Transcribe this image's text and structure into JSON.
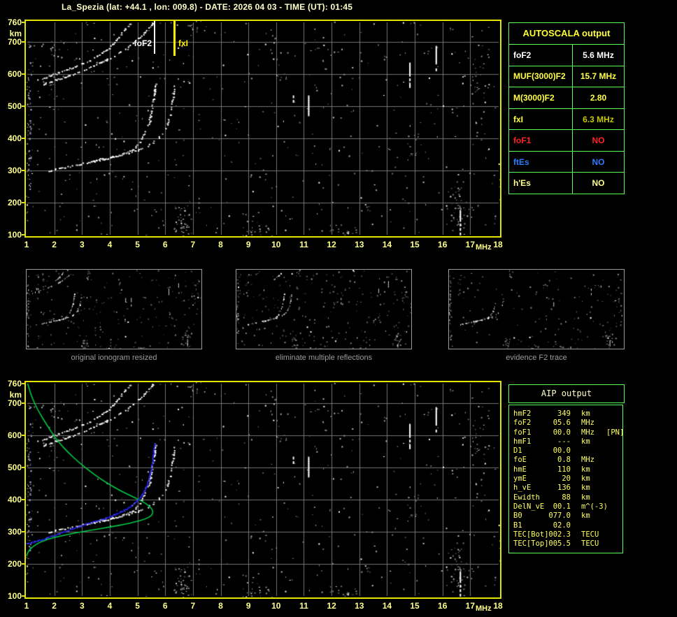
{
  "title": "La_Spezia (lat: +44.1 , lon: 009.8) - DATE: 2026 04 03 - TIME (UT): 01:45",
  "colors": {
    "background": "#000000",
    "plot_border": "#e4e400",
    "grid": "#757575",
    "axis_text": "#ffff8c",
    "table_border": "#55ff55",
    "title_text": "#ffffc8",
    "trace_white": "#ffffff",
    "profile_green": "#00cc44",
    "fitted_blue": "#2020ee"
  },
  "autoscala": {
    "header": "AUTOSCALA output",
    "rows": [
      {
        "key": "foF2",
        "label": "foF2",
        "value": "5.6 MHz",
        "label_color": "#ffffff",
        "value_color": "#ffffff"
      },
      {
        "key": "MUF3000F2",
        "label": "MUF(3000)F2",
        "value": "15.7 MHz",
        "label_color": "#ffff44",
        "value_color": "#ffff44"
      },
      {
        "key": "M3000F2",
        "label": "M(3000)F2",
        "value": "2.80",
        "label_color": "#ffff44",
        "value_color": "#ffff44"
      },
      {
        "key": "fxI",
        "label": "fxI",
        "value": "6.3 MHz",
        "label_color": "#ffff33",
        "value_color": "#c6c600"
      },
      {
        "key": "foF1",
        "label": "foF1",
        "value": "NO",
        "label_color": "#ff2222",
        "value_color": "#ff2222"
      },
      {
        "key": "ftEs",
        "label": "ftEs",
        "value": "NO",
        "label_color": "#2e7bff",
        "value_color": "#2e7bff"
      },
      {
        "key": "hpEs",
        "label": "h'Es",
        "value": "NO",
        "label_color": "#ffff8c",
        "value_color": "#ffff8c"
      }
    ]
  },
  "aip": {
    "header": "AIP output",
    "rows": [
      {
        "name": "hmF2",
        "value": "349",
        "unit": "km",
        "note": ""
      },
      {
        "name": "foF2",
        "value": "05.6",
        "unit": "MHz",
        "note": ""
      },
      {
        "name": "foF1",
        "value": "00.0",
        "unit": "MHz",
        "note": "[PN]"
      },
      {
        "name": "hmF1",
        "value": "---",
        "unit": "km",
        "note": ""
      },
      {
        "name": "D1",
        "value": "00.0",
        "unit": "",
        "note": ""
      },
      {
        "name": "foE",
        "value": "0.8",
        "unit": "MHz",
        "note": ""
      },
      {
        "name": "hmE",
        "value": "110",
        "unit": "km",
        "note": ""
      },
      {
        "name": "ymE",
        "value": "20",
        "unit": "km",
        "note": ""
      },
      {
        "name": "h_vE",
        "value": "136",
        "unit": "km",
        "note": ""
      },
      {
        "name": "Ewidth",
        "value": "88",
        "unit": "km",
        "note": ""
      },
      {
        "name": "DelN_vE",
        "value": "00.1",
        "unit": "m^(-3)",
        "note": ""
      },
      {
        "name": "B0",
        "value": "077.0",
        "unit": "km",
        "note": ""
      },
      {
        "name": "B1",
        "value": "02.0",
        "unit": "",
        "note": ""
      },
      {
        "name": "TEC[Bot]",
        "value": "002.3",
        "unit": "TECU",
        "note": ""
      },
      {
        "name": "TEC[Top]",
        "value": "005.5",
        "unit": "TECU",
        "note": ""
      }
    ]
  },
  "thumbnails": [
    {
      "caption": "original ionogram resized"
    },
    {
      "caption": "eliminate multiple reflections"
    },
    {
      "caption": "evidence F2 trace"
    }
  ],
  "chart_data": [
    {
      "id": "autoscala_ionogram",
      "type": "scatter",
      "xlabel": "MHz",
      "ylabel": "km",
      "xlim": [
        1,
        18
      ],
      "ylim": [
        100,
        760
      ],
      "x_ticks": [
        1,
        2,
        3,
        4,
        5,
        6,
        7,
        8,
        9,
        10,
        11,
        12,
        13,
        14,
        15,
        16,
        17,
        18
      ],
      "y_ticks": [
        100,
        200,
        300,
        400,
        500,
        600,
        700,
        760
      ],
      "grid": true,
      "markers": [
        {
          "label": "foF2",
          "freq_mhz": 5.6,
          "color": "#ffffff"
        },
        {
          "label": "fxI",
          "freq_mhz": 6.3,
          "color": "#ffee00"
        }
      ],
      "traces": {
        "f2_ordinary": [
          [
            1.78,
            300
          ],
          [
            2.1,
            306
          ],
          [
            2.45,
            312
          ],
          [
            2.8,
            318
          ],
          [
            3.15,
            325
          ],
          [
            3.5,
            331
          ],
          [
            3.85,
            337
          ],
          [
            4.15,
            344
          ],
          [
            4.45,
            352
          ],
          [
            4.7,
            361
          ],
          [
            4.9,
            373
          ],
          [
            5.05,
            388
          ],
          [
            5.18,
            406
          ],
          [
            5.3,
            428
          ],
          [
            5.4,
            452
          ],
          [
            5.48,
            480
          ],
          [
            5.54,
            510
          ],
          [
            5.59,
            538
          ],
          [
            5.62,
            560
          ],
          [
            5.64,
            572
          ]
        ],
        "f2_extraordinary": [
          [
            3.35,
            331
          ],
          [
            3.7,
            337
          ],
          [
            4.05,
            343
          ],
          [
            4.4,
            350
          ],
          [
            4.75,
            358
          ],
          [
            5.05,
            366
          ],
          [
            5.3,
            376
          ],
          [
            5.55,
            388
          ],
          [
            5.75,
            402
          ],
          [
            5.92,
            420
          ],
          [
            6.05,
            442
          ],
          [
            6.15,
            468
          ],
          [
            6.22,
            498
          ],
          [
            6.27,
            528
          ],
          [
            6.3,
            552
          ],
          [
            6.32,
            568
          ]
        ],
        "second_hop_a": [
          [
            1.35,
            580
          ],
          [
            1.7,
            592
          ],
          [
            2.1,
            604
          ],
          [
            2.5,
            616
          ],
          [
            2.9,
            630
          ],
          [
            3.25,
            644
          ],
          [
            3.6,
            660
          ],
          [
            3.9,
            678
          ],
          [
            4.15,
            700
          ],
          [
            4.4,
            724
          ],
          [
            4.6,
            746
          ],
          [
            4.75,
            762
          ]
        ],
        "second_hop_b": [
          [
            1.55,
            568
          ],
          [
            1.95,
            580
          ],
          [
            2.4,
            592
          ],
          [
            2.85,
            606
          ],
          [
            3.3,
            622
          ],
          [
            3.75,
            640
          ],
          [
            4.15,
            658
          ],
          [
            4.55,
            678
          ],
          [
            4.9,
            700
          ],
          [
            5.2,
            724
          ],
          [
            5.45,
            748
          ],
          [
            5.58,
            764
          ]
        ]
      },
      "interference_mhz_kmlo_kmhi": [
        [
          10.6,
          505,
          540
        ],
        [
          11.15,
          470,
          552
        ],
        [
          14.8,
          565,
          635
        ],
        [
          15.75,
          610,
          688
        ],
        [
          16.62,
          100,
          180
        ]
      ],
      "noise_seed": 20260403,
      "noise_clusters": [
        [
          1.08,
          430,
          0.13,
          330,
          80
        ],
        [
          2.0,
          600,
          0.2,
          140,
          18
        ],
        [
          6.6,
          140,
          0.35,
          70,
          45
        ],
        [
          7.0,
          737,
          0.25,
          40,
          14
        ],
        [
          16.55,
          200,
          0.5,
          130,
          55
        ],
        [
          17.35,
          560,
          0.45,
          200,
          35
        ],
        [
          14.9,
          380,
          0.3,
          80,
          12
        ],
        [
          10.2,
          625,
          0.4,
          60,
          10
        ],
        [
          9.3,
          115,
          0.8,
          30,
          25
        ],
        [
          12.5,
          110,
          1.2,
          25,
          20
        ]
      ]
    },
    {
      "id": "aip_ionogram",
      "type": "scatter",
      "xlabel": "MHz",
      "ylabel": "km",
      "xlim": [
        1,
        18
      ],
      "ylim": [
        100,
        760
      ],
      "x_ticks": [
        1,
        2,
        3,
        4,
        5,
        6,
        7,
        8,
        9,
        10,
        11,
        12,
        13,
        14,
        15,
        16,
        17,
        18
      ],
      "y_ticks": [
        100,
        200,
        300,
        400,
        500,
        600,
        700,
        760
      ],
      "grid": true,
      "profile_color": "#00cc44",
      "profile_green": [
        [
          1.04,
          760
        ],
        [
          1.14,
          730
        ],
        [
          1.28,
          700
        ],
        [
          1.47,
          668
        ],
        [
          1.7,
          636
        ],
        [
          1.95,
          602
        ],
        [
          2.2,
          574
        ],
        [
          2.5,
          546
        ],
        [
          2.85,
          518
        ],
        [
          3.25,
          490
        ],
        [
          3.7,
          462
        ],
        [
          4.15,
          438
        ],
        [
          4.6,
          418
        ],
        [
          5.0,
          402
        ],
        [
          5.3,
          388
        ],
        [
          5.5,
          374
        ],
        [
          5.57,
          361
        ],
        [
          5.5,
          349
        ],
        [
          5.28,
          339
        ],
        [
          4.95,
          331
        ],
        [
          4.55,
          323
        ],
        [
          4.05,
          315
        ],
        [
          3.5,
          307
        ],
        [
          2.95,
          299
        ],
        [
          2.5,
          292
        ],
        [
          2.1,
          284
        ],
        [
          1.75,
          276
        ],
        [
          1.48,
          267
        ],
        [
          1.28,
          257
        ],
        [
          1.13,
          246
        ],
        [
          1.04,
          235
        ],
        [
          1.0,
          224
        ]
      ],
      "fitted_color": "#2020ee",
      "fitted_trace_blue": [
        [
          1.0,
          262
        ],
        [
          1.3,
          268
        ],
        [
          1.6,
          276
        ],
        [
          1.9,
          285
        ],
        [
          2.2,
          294
        ],
        [
          2.5,
          303
        ],
        [
          2.8,
          312
        ],
        [
          3.1,
          321
        ],
        [
          3.4,
          329
        ],
        [
          3.7,
          337
        ],
        [
          4.0,
          346
        ],
        [
          4.3,
          356
        ],
        [
          4.55,
          367
        ],
        [
          4.78,
          379
        ],
        [
          4.97,
          392
        ],
        [
          5.12,
          407
        ],
        [
          5.25,
          424
        ],
        [
          5.35,
          444
        ],
        [
          5.44,
          468
        ],
        [
          5.5,
          494
        ],
        [
          5.55,
          520
        ],
        [
          5.58,
          545
        ],
        [
          5.61,
          566
        ],
        [
          5.63,
          578
        ]
      ]
    }
  ]
}
